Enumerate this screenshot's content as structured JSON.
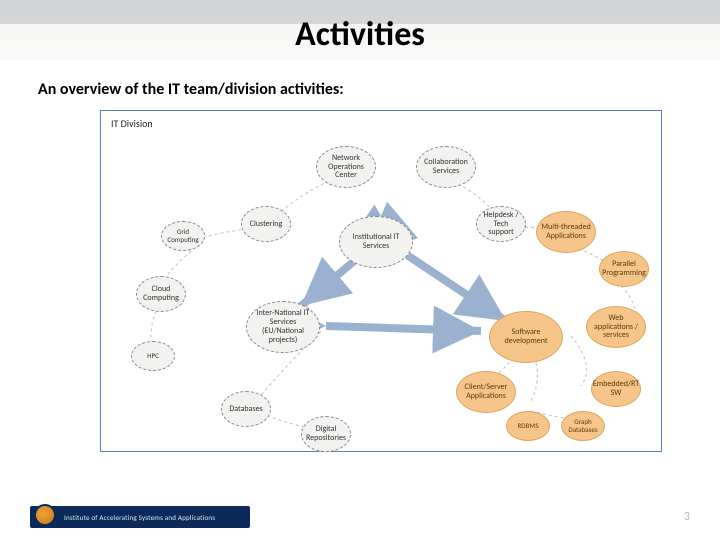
{
  "title": "Activities",
  "subtitle": "An overview of the IT team/division activities:",
  "diagram": {
    "division_label": "IT Division",
    "nodes": {
      "noc": {
        "label": "Network Operations Center"
      },
      "collab": {
        "label": "Collaboration Services"
      },
      "clustering": {
        "label": "Clustering"
      },
      "grid": {
        "label": "Grid Computing"
      },
      "helpdesk": {
        "label": "Helpdesk / Tech support"
      },
      "inst": {
        "label": "Institutional IT Services"
      },
      "multi": {
        "label": "Multi-threaded Applications"
      },
      "parallel": {
        "label": "Parallel Programming"
      },
      "cloud": {
        "label": "Cloud Computing"
      },
      "hpc": {
        "label": "HPC"
      },
      "inter": {
        "label": "Inter-National IT Services (EU/National projects)"
      },
      "swdev": {
        "label": "Software development"
      },
      "webapp": {
        "label": "Web applications / services"
      },
      "cliserv": {
        "label": "Client/Server Applications"
      },
      "embedded": {
        "label": "Embedded/RT SW"
      },
      "databases": {
        "label": "Databases"
      },
      "digrepo": {
        "label": "Digital Repositories"
      },
      "rdbms": {
        "label": "RDBMS"
      },
      "graphdb": {
        "label": "Graph Databases"
      }
    }
  },
  "footer": {
    "institute": "Institute of Accelerating Systems and Applications",
    "page": "3"
  }
}
